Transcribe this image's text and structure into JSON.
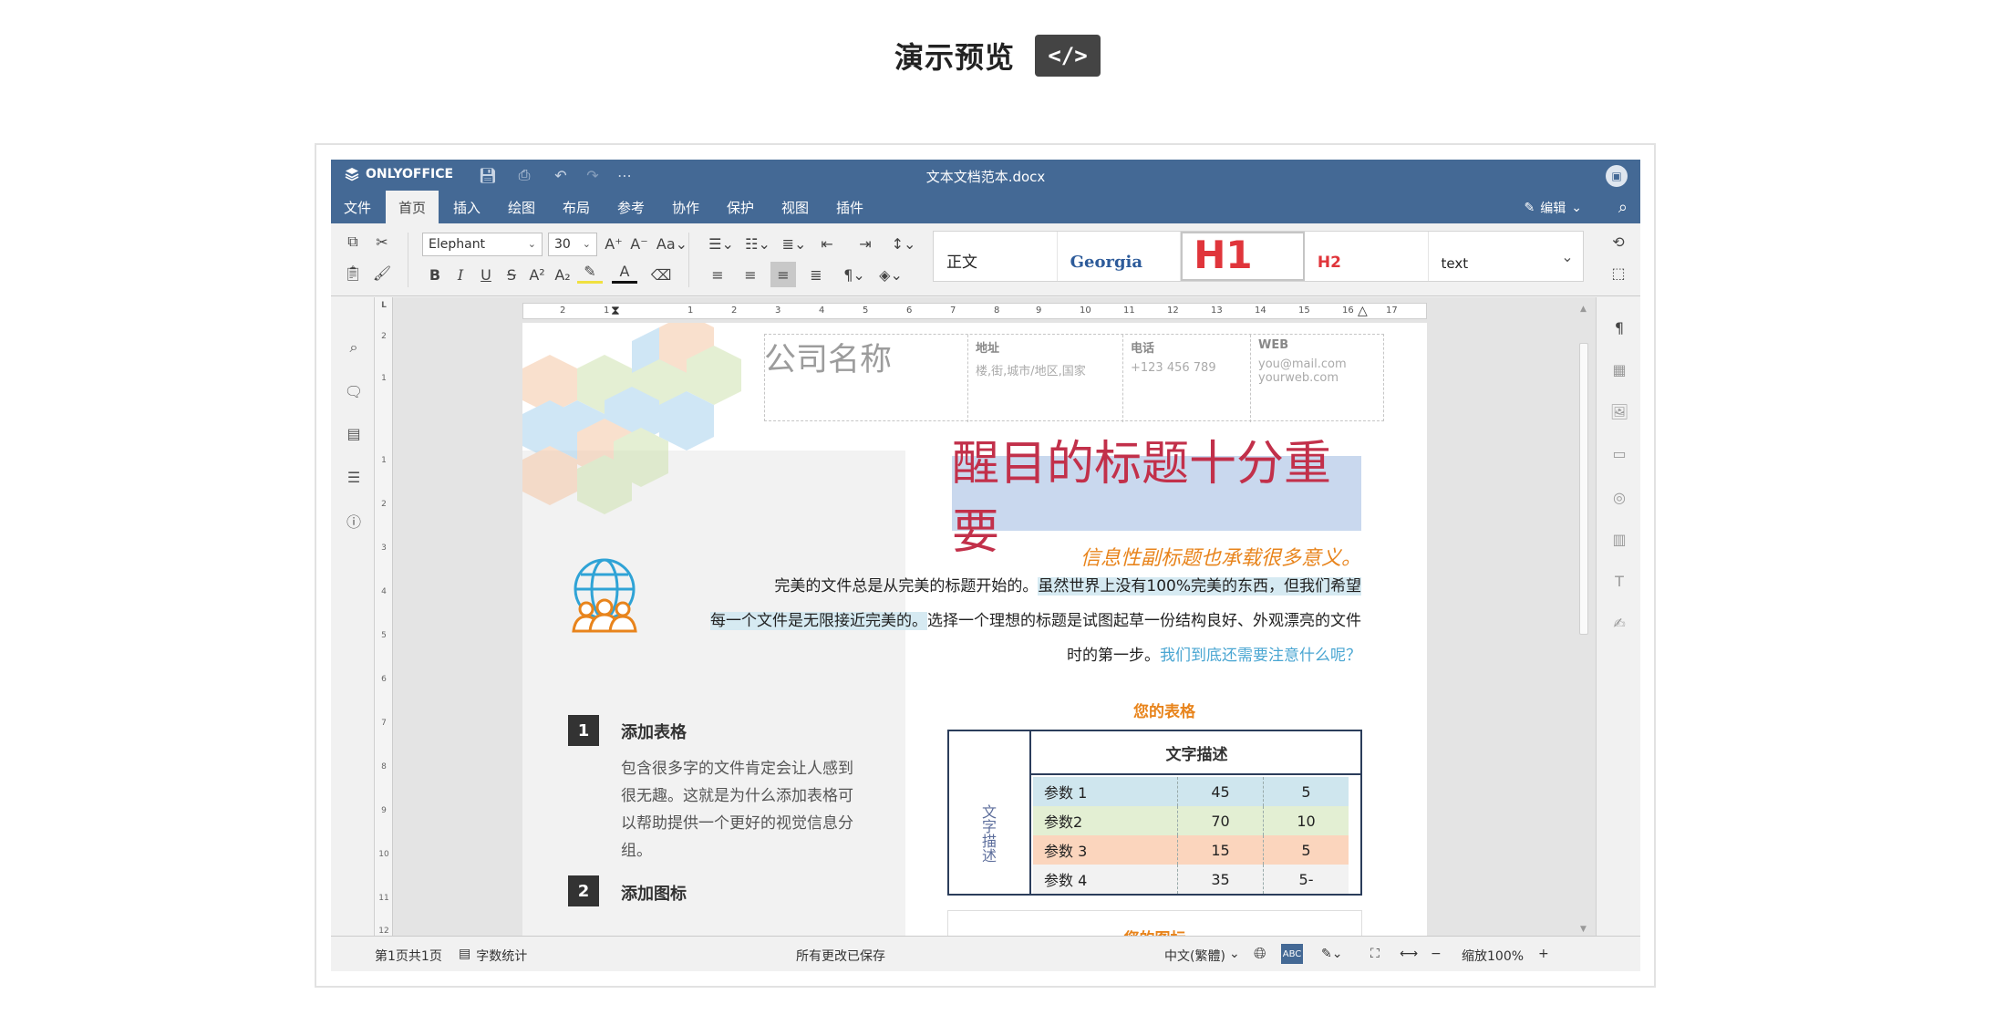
{
  "page": {
    "title": "演示预览",
    "code_button": "</>"
  },
  "app": {
    "brand": "ONLYOFFICE",
    "doc_title": "文本文档范本.docx",
    "tabs": [
      "文件",
      "首页",
      "插入",
      "绘图",
      "布局",
      "参考",
      "协作",
      "保护",
      "视图",
      "插件"
    ],
    "active_tab": "首页",
    "edit_mode": "编辑",
    "toolbar": {
      "font_name": "Elephant",
      "font_size": "30",
      "styles": [
        {
          "label": "正文"
        },
        {
          "label": "Georgia"
        },
        {
          "label": "H1"
        },
        {
          "label": "H2"
        },
        {
          "label": "text"
        }
      ]
    },
    "ruler_marks": [
      "2",
      "1",
      "1",
      "2",
      "3",
      "4",
      "5",
      "6",
      "7",
      "8",
      "9",
      "10",
      "11",
      "12",
      "13",
      "14",
      "15",
      "16",
      "17"
    ],
    "vruler_marks": [
      "2",
      "1",
      "1",
      "2",
      "3",
      "4",
      "5",
      "6",
      "7",
      "8",
      "9",
      "10",
      "11",
      "12"
    ],
    "document": {
      "company": "公司名称",
      "address_label": "地址",
      "address_value": "楼,街,城市/地区,国家",
      "phone_label": "电话",
      "phone_value": "+123 456 789",
      "web_label": "WEB",
      "web_email": "you@mail.com",
      "web_site": "yourweb.com",
      "headline": "醒目的标题十分重要",
      "subtitle": "信息性副标题也承载很多意义。",
      "body_1": "完美的文件总是从完美的标题开始的。",
      "body_2": "虽然世界上没有100%完美的东西，但我们希望",
      "body_3": "每一个文件是无限接近完美的。",
      "body_4": "选择一个理想的标题是试图起草一份结构良好、外观漂亮的文件",
      "body_5": "时的第一步。",
      "body_6": "我们到底还需要注意什么呢？",
      "step1_num": "1",
      "step1_title": "添加表格",
      "step1_body": "包含很多字的文件肯定会让人感到很无趣。这就是为什么添加表格可以帮助提供一个更好的视觉信息分组。",
      "step2_num": "2",
      "step2_title": "添加图标",
      "table_caption": "您的表格",
      "table_header": "文字描述",
      "table_side": "文字描述",
      "table_rows": [
        {
          "label": "参数 1",
          "v1": "45",
          "v2": "5",
          "color": "#cfe6ee"
        },
        {
          "label": "参数2",
          "v1": "70",
          "v2": "10",
          "color": "#e3efd3"
        },
        {
          "label": "参数 3",
          "v1": "15",
          "v2": "5",
          "color": "#fbd5bd"
        },
        {
          "label": "参数 4",
          "v1": "35",
          "v2": "5-",
          "color": "#f2f2f2"
        }
      ],
      "chart_caption": "您的图标"
    },
    "status": {
      "page": "第1页共1页",
      "word_count": "字数统计",
      "saved": "所有更改已保存",
      "language": "中文(繁體)",
      "zoom": "缩放100%"
    }
  }
}
